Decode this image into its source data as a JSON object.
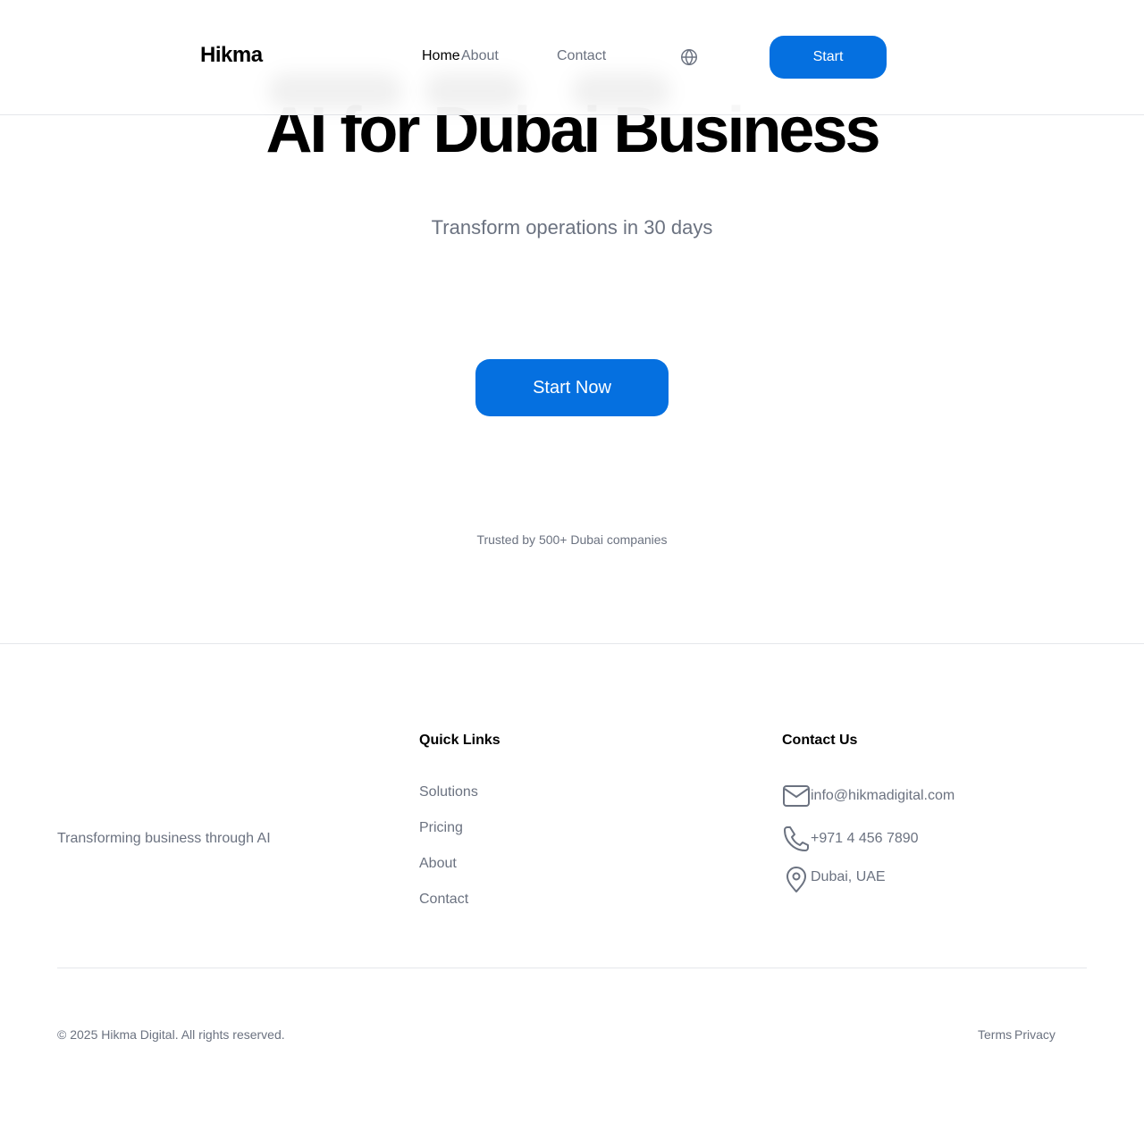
{
  "header": {
    "logo": "Hikma",
    "nav": [
      {
        "label": "Home",
        "active": true
      },
      {
        "label": "About",
        "active": false
      },
      {
        "label": "Contact",
        "active": false
      }
    ],
    "language_icon": "globe-icon",
    "cta_label": "Start"
  },
  "hero": {
    "title": "AI for Dubai Business",
    "subtitle": "Transform operations in 30 days",
    "cta_label": "Start Now",
    "trust_text": "Trusted by 500+ Dubai companies"
  },
  "footer": {
    "tagline": "Transforming business through AI",
    "quick_links": {
      "title": "Quick Links",
      "items": [
        "Solutions",
        "Pricing",
        "About",
        "Contact"
      ]
    },
    "contact": {
      "title": "Contact Us",
      "email": "info@hikmadigital.com",
      "phone": "+971 4 456 7890",
      "location": "Dubai, UAE",
      "icons": [
        "mail-icon",
        "phone-icon",
        "map-pin-icon"
      ]
    },
    "copyright": "© 2025 Hikma Digital. All rights reserved.",
    "legal_links": [
      "Terms",
      "Privacy"
    ]
  },
  "colors": {
    "accent": "#0570e0",
    "text_primary": "#000000",
    "text_muted": "#6b7280",
    "border": "#e5e7eb",
    "background": "#ffffff"
  }
}
